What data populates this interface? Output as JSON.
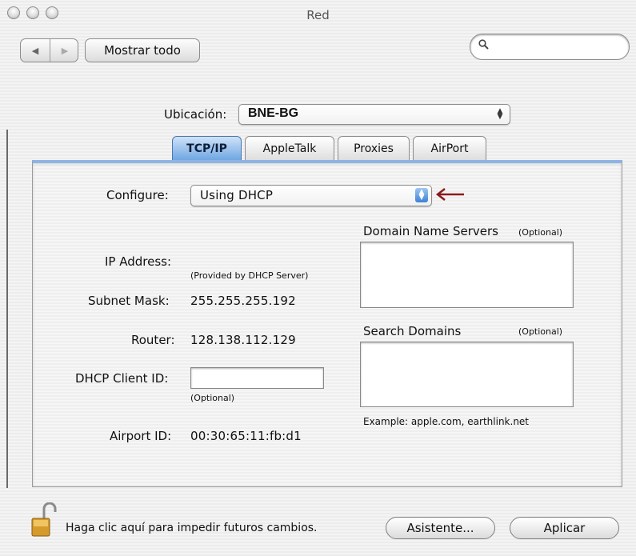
{
  "window": {
    "title": "Red"
  },
  "toolbar": {
    "back_glyph": "◀",
    "forward_glyph": "▶",
    "show_all_label": "Mostrar todo",
    "search_value": ""
  },
  "location": {
    "label": "Ubicación:",
    "value": "BNE-BG"
  },
  "tabs": [
    {
      "label": "TCP/IP",
      "selected": true
    },
    {
      "label": "AppleTalk",
      "selected": false
    },
    {
      "label": "Proxies",
      "selected": false
    },
    {
      "label": "AirPort",
      "selected": false
    }
  ],
  "tcpip": {
    "configure_label": "Configure:",
    "configure_value": "Using DHCP",
    "ip_label": "IP Address:",
    "ip_hint": "(Provided by DHCP Server)",
    "subnet_label": "Subnet Mask:",
    "subnet_value": "255.255.255.192",
    "router_label": "Router:",
    "router_value": "128.138.112.129",
    "dhcp_label": "DHCP Client ID:",
    "dhcp_value": "",
    "dhcp_hint": "(Optional)",
    "airport_label": "Airport ID:",
    "airport_value": "00:30:65:11:fb:d1",
    "dns_label": "Domain Name Servers",
    "dns_optional": "(Optional)",
    "search_domains_label": "Search Domains",
    "search_domains_optional": "(Optional)",
    "search_example": "Example: apple.com, earthlink.net"
  },
  "footer": {
    "lock_text": "Haga clic aquí para impedir futuros cambios.",
    "assistant_label": "Asistente...",
    "apply_label": "Aplicar"
  },
  "colors": {
    "accent_blue": "#6fa7e2",
    "arrow_red": "#8b1a1a"
  },
  "icons": {
    "lock": "lock-icon",
    "search": "search-icon",
    "arrow": "arrow-left-icon"
  }
}
